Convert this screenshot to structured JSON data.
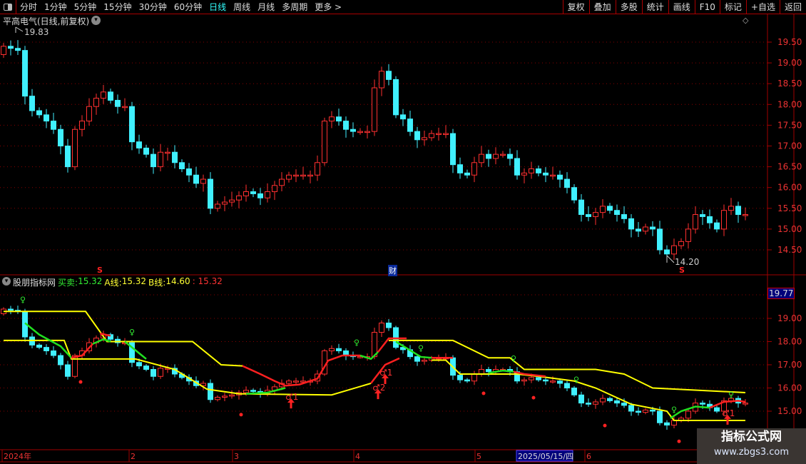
{
  "toolbar": {
    "periods": [
      "分时",
      "1分钟",
      "5分钟",
      "15分钟",
      "30分钟",
      "60分钟",
      "日线",
      "周线",
      "月线",
      "多周期",
      "更多 >"
    ],
    "active_period": "日线",
    "buttons": [
      "复权",
      "叠加",
      "多股",
      "统计",
      "画线",
      "F10",
      "标记",
      "+自选",
      "返回"
    ]
  },
  "main_panel": {
    "title": "平高电气(日线,前复权)",
    "high_label": "19.83",
    "low_label": "14.20",
    "signal_s": "S",
    "finance_badge": "财",
    "price_ticks": [
      "19.50",
      "19.00",
      "18.50",
      "18.00",
      "17.50",
      "17.00",
      "16.50",
      "16.00",
      "15.50",
      "15.00",
      "14.50"
    ]
  },
  "indicator_panel": {
    "name": "股朋指标网",
    "buysell_label": "买卖:",
    "buysell_value": "15.32",
    "a_label": "A线:",
    "a_value": "15.32",
    "b_label": "B线:",
    "b_value": "14.60",
    "extra_value": ": 15.32",
    "cursor_price": "19.77",
    "price_ticks": [
      "19.00",
      "18.00",
      "17.00",
      "16.00",
      "15.00"
    ],
    "buy_marks": [
      "♂1",
      "♂2",
      "♂1",
      "♂1"
    ],
    "sell_mark": "♀"
  },
  "time_axis": {
    "labels": [
      "2024年",
      "2",
      "3",
      "4",
      "5",
      "6"
    ],
    "cursor_date": "2025/05/15/四"
  },
  "watermark": {
    "title": "指标公式网",
    "url": "www.zbgs3.com"
  },
  "colors": {
    "up": "#ff3030",
    "down": "#40f0ff",
    "a_line": "#ffff00",
    "buy_line": "#ff2020",
    "sell_line": "#20e020",
    "grid": "#a00000",
    "active": "#33ffff"
  },
  "chart_data": {
    "type": "candlestick",
    "close": [
      19.4,
      19.35,
      19.3,
      18.2,
      17.85,
      17.75,
      17.6,
      17.4,
      17.0,
      16.5,
      17.4,
      17.6,
      17.95,
      18.15,
      18.3,
      18.1,
      17.95,
      17.95,
      17.1,
      16.95,
      16.8,
      16.5,
      16.85,
      16.85,
      16.6,
      16.45,
      16.3,
      16.1,
      16.2,
      15.5,
      15.6,
      15.65,
      15.7,
      15.8,
      15.9,
      15.85,
      15.75,
      15.9,
      16.05,
      16.2,
      16.3,
      16.3,
      16.3,
      16.3,
      16.6,
      17.6,
      17.7,
      17.6,
      17.4,
      17.35,
      17.35,
      17.35,
      18.4,
      18.8,
      18.6,
      17.75,
      17.65,
      17.35,
      17.15,
      17.2,
      17.3,
      17.3,
      17.3,
      16.55,
      16.35,
      16.3,
      16.6,
      16.8,
      16.7,
      16.8,
      16.8,
      16.7,
      16.3,
      16.35,
      16.45,
      16.35,
      16.3,
      16.3,
      16.2,
      16.0,
      15.7,
      15.35,
      15.3,
      15.4,
      15.55,
      15.45,
      15.35,
      15.25,
      15.0,
      14.95,
      15.05,
      15.0,
      14.5,
      14.4,
      14.6,
      14.7,
      15.0,
      15.35,
      15.3,
      15.15,
      15.0,
      15.45,
      15.55,
      15.35,
      15.35
    ],
    "first_open": 19.2,
    "main_ylim": [
      14.0,
      19.9
    ],
    "indicator_ylim": [
      13.5,
      19.9
    ],
    "a_line": [
      [
        0,
        19.3
      ],
      [
        11.5,
        19.3
      ],
      [
        14.5,
        18.0
      ],
      [
        26.5,
        18.0
      ],
      [
        30.5,
        17.0
      ],
      [
        33.5,
        16.95
      ],
      null,
      [
        54,
        18.05
      ],
      [
        63,
        18.05
      ],
      [
        68,
        17.3
      ],
      [
        71,
        17.3
      ],
      [
        73,
        16.8
      ],
      [
        83,
        16.8
      ],
      [
        87,
        16.6
      ],
      [
        91,
        16.0
      ],
      [
        104,
        15.8
      ]
    ],
    "b_line": [
      [
        0,
        18.05
      ],
      [
        8.5,
        18.05
      ],
      [
        9.5,
        17.25
      ],
      [
        18.5,
        17.25
      ],
      [
        24,
        16.8
      ],
      [
        28.5,
        15.95
      ],
      [
        33,
        15.75
      ],
      [
        46,
        15.7
      ],
      [
        51.5,
        16.2
      ],
      null,
      [
        60,
        17.2
      ],
      [
        62,
        17.2
      ],
      [
        64,
        16.6
      ],
      [
        72,
        16.6
      ],
      [
        75,
        16.5
      ],
      [
        80,
        16.3
      ],
      [
        83,
        16.0
      ],
      [
        88,
        15.3
      ],
      [
        93,
        15.0
      ],
      [
        94,
        14.6
      ],
      [
        104,
        14.6
      ]
    ],
    "signal_segments": [
      {
        "trend": "sell",
        "points": [
          [
            3,
            18.8
          ],
          [
            5,
            18.3
          ],
          [
            8,
            17.8
          ],
          [
            9.5,
            17.3
          ]
        ]
      },
      {
        "trend": "buy",
        "points": [
          [
            9.5,
            17.3
          ],
          [
            11,
            17.4
          ],
          [
            12.5,
            17.9
          ]
        ]
      },
      {
        "trend": "sell",
        "points": [
          [
            12.5,
            17.9
          ],
          [
            14,
            18.1
          ],
          [
            15,
            18.0
          ]
        ]
      },
      {
        "trend": "buy",
        "points": [
          [
            13.5,
            18.35
          ],
          [
            15,
            18.25
          ]
        ]
      },
      {
        "trend": "sell",
        "points": [
          [
            17,
            18.0
          ],
          [
            19,
            17.5
          ],
          [
            20,
            17.25
          ]
        ]
      },
      {
        "trend": "buy",
        "points": [
          [
            33.5,
            16.95
          ],
          [
            36,
            16.6
          ],
          [
            38,
            16.3
          ],
          [
            39.5,
            16.1
          ],
          [
            41.5,
            16.15
          ],
          [
            44,
            16.4
          ],
          [
            45.5,
            17.18
          ],
          [
            47.5,
            17.4
          ],
          [
            50,
            17.4
          ]
        ]
      },
      {
        "trend": "sell",
        "points": [
          [
            34,
            15.75
          ],
          [
            37,
            15.8
          ],
          [
            39.5,
            16.0
          ]
        ]
      },
      {
        "trend": "sell",
        "points": [
          [
            50,
            17.4
          ],
          [
            51.5,
            17.25
          ],
          [
            52.5,
            17.55
          ]
        ]
      },
      {
        "trend": "buy",
        "points": [
          [
            52.5,
            17.55
          ],
          [
            54,
            18.14
          ],
          [
            56.5,
            18.14
          ]
        ]
      },
      {
        "trend": "sell",
        "points": [
          [
            55,
            18.0
          ],
          [
            58.5,
            17.34
          ],
          [
            60,
            17.3
          ]
        ]
      },
      {
        "trend": "buy",
        "points": [
          [
            60,
            17.3
          ],
          [
            63,
            17.3
          ]
        ]
      },
      {
        "trend": "buy",
        "points": [
          [
            51.5,
            16.2
          ],
          [
            53.5,
            17.0
          ],
          [
            55.5,
            17.28
          ]
        ]
      },
      {
        "trend": "sell",
        "points": [
          [
            68,
            16.65
          ],
          [
            70,
            16.75
          ],
          [
            71.5,
            16.7
          ]
        ]
      },
      {
        "trend": "buy",
        "points": [
          [
            71.5,
            16.7
          ],
          [
            73,
            16.6
          ],
          [
            76,
            16.5
          ]
        ]
      },
      {
        "trend": "sell",
        "points": [
          [
            93.5,
            14.7
          ],
          [
            95,
            15.0
          ],
          [
            97,
            15.2
          ],
          [
            99,
            15.15
          ]
        ]
      },
      {
        "trend": "buy",
        "points": [
          [
            99,
            15.15
          ],
          [
            101,
            15.4
          ],
          [
            103,
            15.45
          ],
          [
            104,
            15.4
          ]
        ]
      }
    ],
    "red_dots": [
      [
        10.8,
        16.26
      ],
      [
        33.3,
        14.85
      ],
      [
        67.3,
        15.77
      ],
      [
        74.3,
        15.58
      ],
      [
        84.3,
        14.38
      ],
      [
        94.7,
        13.7
      ]
    ],
    "sell_marks": [
      [
        2.7,
        19.7
      ],
      [
        18,
        18.3
      ],
      [
        49.5,
        17.85
      ],
      [
        58.5,
        17.6
      ],
      [
        71.5,
        17.15
      ],
      [
        80.3,
        16.25
      ],
      [
        94,
        14.95
      ],
      [
        102,
        15.6
      ]
    ],
    "buy_marks": [
      [
        40.3,
        15.55
      ],
      [
        52.5,
        15.95
      ],
      [
        53.5,
        16.6
      ],
      [
        101.5,
        14.85
      ]
    ]
  }
}
